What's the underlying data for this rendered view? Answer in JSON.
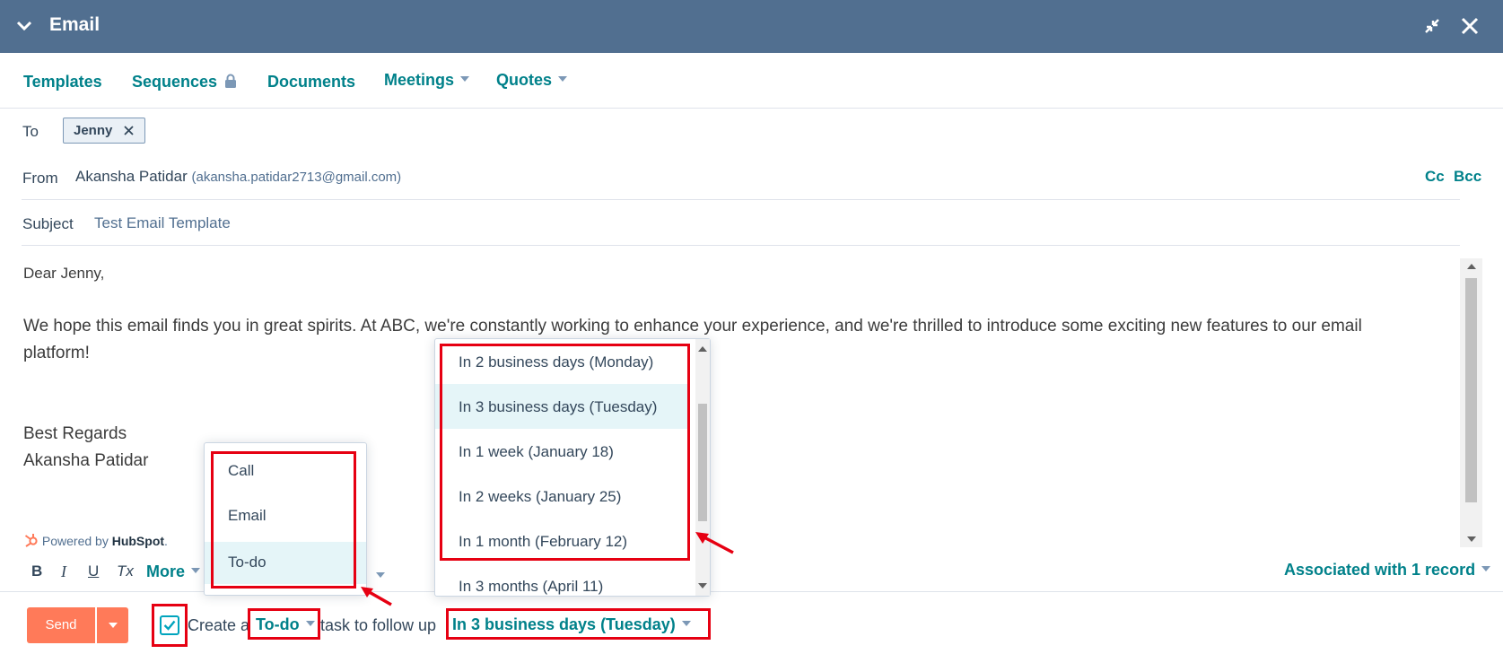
{
  "titlebar": {
    "title": "Email",
    "minimize_icon": "minimize-icon",
    "close_icon": "close-icon"
  },
  "toolbar": {
    "templates": "Templates",
    "sequences": "Sequences",
    "documents": "Documents",
    "meetings": "Meetings",
    "quotes": "Quotes"
  },
  "recipients": {
    "to_label": "To",
    "to_chip": "Jenny",
    "from_label": "From",
    "from_name": "Akansha Patidar",
    "from_email": "(akansha.patidar2713@gmail.com)",
    "cc": "Cc",
    "bcc": "Bcc",
    "subject_label": "Subject",
    "subject_value": "Test Email Template"
  },
  "body": {
    "greeting": "Dear Jenny,",
    "line1": "We hope this email finds you in great spirits. At ABC, we're constantly working to enhance your experience, and we're thrilled to introduce some exciting new features to our email",
    "line2": "platform!",
    "regards": "Best Regards",
    "signature": "Akansha Patidar"
  },
  "powered_by": {
    "prefix": "Powered by ",
    "brand": "HubSpot",
    "suffix": "."
  },
  "format_bar": {
    "bold": "B",
    "italic": "I",
    "underline": "U",
    "clear": "Tx",
    "more": "More",
    "associated": "Associated with 1 record"
  },
  "task_type_dropdown": {
    "options": [
      "Call",
      "Email",
      "To-do"
    ],
    "selected": "To-do"
  },
  "due_dropdown": {
    "options": [
      "In 2 business days (Monday)",
      "In 3 business days (Tuesday)",
      "In 1 week (January 18)",
      "In 2 weeks (January 25)",
      "In 1 month (February 12)",
      "In 3 months (April 11)"
    ],
    "selected": "In 3 business days (Tuesday)"
  },
  "footer": {
    "send": "Send",
    "create_prefix": "Create a",
    "task_type": "To-do",
    "task_middle": "task to follow up",
    "due": "In 3 business days (Tuesday)",
    "checkbox_checked": true
  },
  "colors": {
    "header": "#516f90",
    "accent": "#00818a",
    "send": "#ff7a59",
    "highlight": "#e60012"
  }
}
